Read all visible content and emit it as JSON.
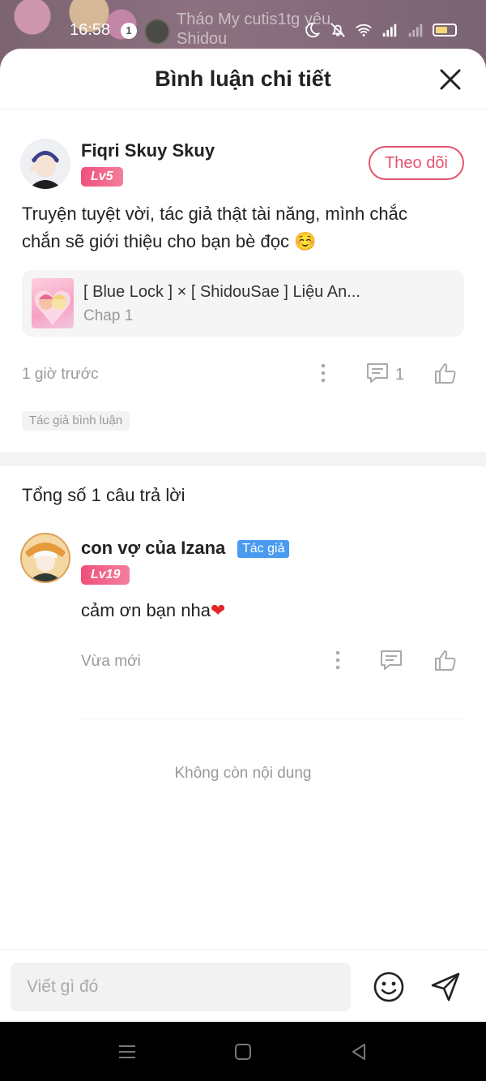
{
  "status_bar": {
    "time": "16:58",
    "notification_count": "1",
    "notification_text": "Tháo My cutis1tg yêu Shidou"
  },
  "header": {
    "title": "Bình luận chi tiết"
  },
  "comment": {
    "username": "Fiqri Skuy Skuy",
    "level": "Lv5",
    "follow_label": "Theo dõi",
    "text": "Truyện tuyệt vời, tác giả thật tài năng, mình chắc chắn sẽ giới thiệu cho bạn bè đọc ☺️",
    "story": {
      "title": "[ Blue Lock ] × [ ShidouSae ] Liệu An...",
      "chapter": "Chap 1"
    },
    "time": "1 giờ trước",
    "reply_count": "1",
    "tag": "Tác giả bình luận"
  },
  "replies": {
    "summary": "Tổng số 1 câu trả lời",
    "items": [
      {
        "username": "con vợ của Izana",
        "author_tag": "Tác giả",
        "level": "Lv19",
        "text": "cảm ơn bạn nha",
        "time": "Vừa mới"
      }
    ],
    "end_text": "Không còn nội dung"
  },
  "input": {
    "placeholder": "Viết gì đó"
  },
  "colors": {
    "accent": "#e5546f",
    "author_tag": "#4a9bf0",
    "muted": "#999999"
  }
}
